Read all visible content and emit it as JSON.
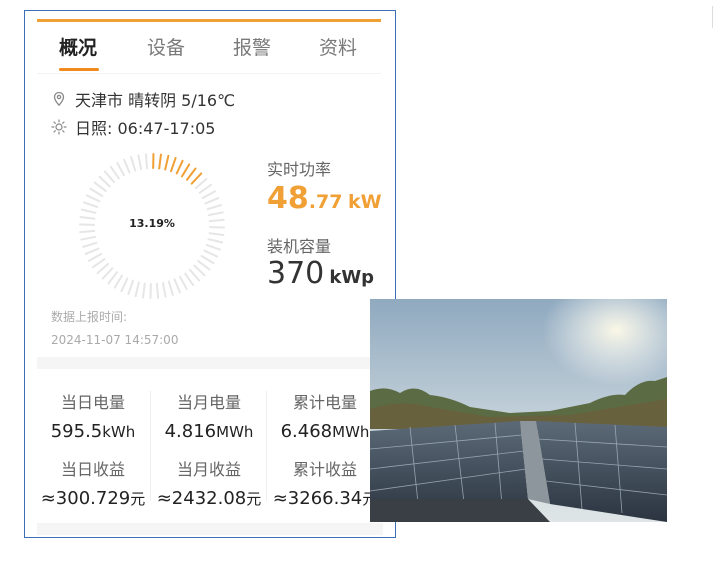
{
  "tabs": [
    {
      "label": "概况",
      "active": true
    },
    {
      "label": "设备",
      "active": false
    },
    {
      "label": "报警",
      "active": false
    },
    {
      "label": "资料",
      "active": false
    }
  ],
  "location": {
    "icon": "location-pin-icon",
    "text": "天津市 晴转阴 5/16℃"
  },
  "sunshine": {
    "icon": "sun-icon",
    "text": "日照: 06:47-17:05"
  },
  "gauge": {
    "percent_text": "13.19%",
    "fraction": 0.1319,
    "accent": "#f0a035",
    "track": "#e6e6e6"
  },
  "realtime_power": {
    "label": "实时功率",
    "value_int": "48",
    "value_dec": ".77",
    "unit": "kW"
  },
  "capacity": {
    "label": "装机容量",
    "value": "370",
    "unit": "kWp"
  },
  "report": {
    "label": "数据上报时间:",
    "time": "2024-11-07 14:57:00"
  },
  "energy": [
    {
      "label": "当日电量",
      "value": "595.5",
      "unit": "kWh"
    },
    {
      "label": "当月电量",
      "value": "4.816",
      "unit": "MWh"
    },
    {
      "label": "累计电量",
      "value": "6.468",
      "unit": "MWh"
    }
  ],
  "revenue": [
    {
      "label": "当日收益",
      "value": "≈300.729",
      "unit": "元"
    },
    {
      "label": "当月收益",
      "value": "≈2432.08",
      "unit": "元"
    },
    {
      "label": "累计收益",
      "value": "≈3266.34",
      "unit": "元"
    }
  ],
  "colors": {
    "accent": "#f0a035",
    "tab_underline": "#f08a1c",
    "frame_border": "#3b6fb6"
  }
}
